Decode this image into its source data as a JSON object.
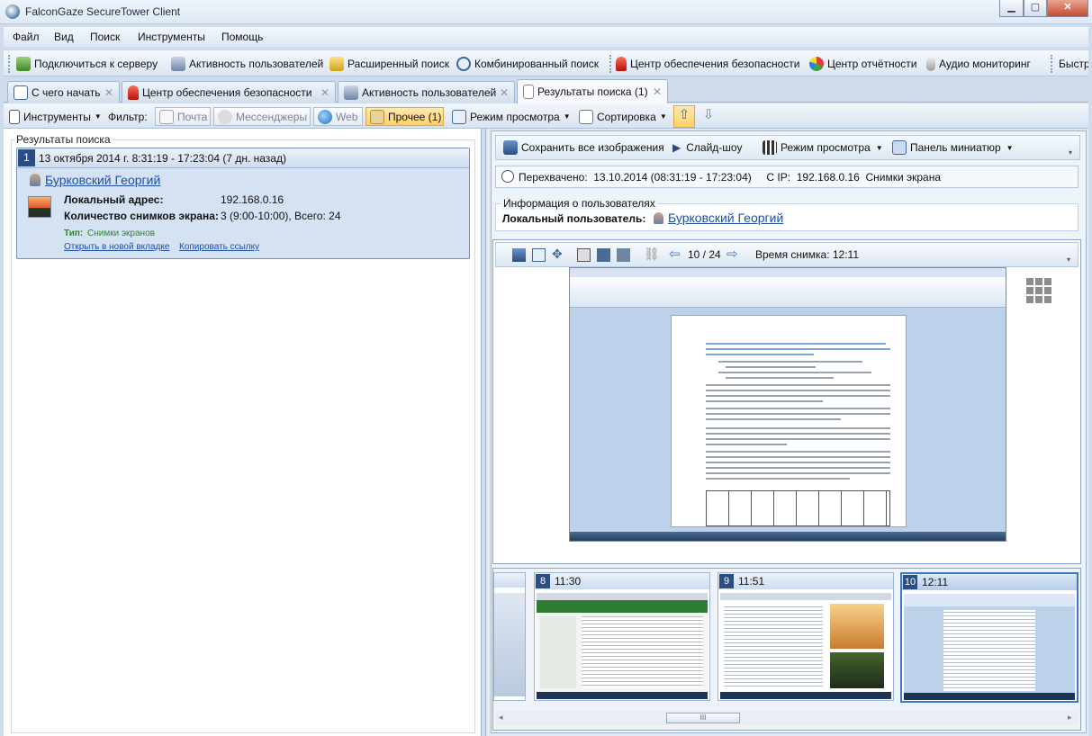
{
  "window": {
    "title": "FalconGaze SecureTower Client"
  },
  "menu": [
    "Файл",
    "Вид",
    "Поиск",
    "Инструменты",
    "Помощь"
  ],
  "toolbar": {
    "connect": "Подключиться к серверу",
    "user_activity": "Активность пользователей",
    "advanced_search": "Расширенный поиск",
    "combined_search": "Комбинированный поиск",
    "security_center": "Центр обеспечения безопасности",
    "reports_center": "Центр отчётности",
    "audio_monitoring": "Аудио мониторинг",
    "overflow": "Быстр"
  },
  "tabs": [
    {
      "label": "С чего начать",
      "icon": "list-icon"
    },
    {
      "label": "Центр обеспечения безопасности",
      "icon": "alarm-icon"
    },
    {
      "label": "Активность пользователей",
      "icon": "activity-icon"
    },
    {
      "label": "Результаты поиска (1)",
      "icon": "document-icon"
    }
  ],
  "filterbar": {
    "tools": "Инструменты",
    "filter_label": "Фильтр:",
    "mail": "Почта",
    "messengers": "Мессенджеры",
    "web": "Web",
    "other": "Прочее (1)",
    "view_mode": "Режим просмотра",
    "sorting": "Сортировка"
  },
  "left": {
    "group_title": "Результаты поиска",
    "result": {
      "index": "1",
      "header": "13 октября 2014 г. 8:31:19 - 17:23:04 (7 дн. назад)",
      "user": "Бурковский Георгий",
      "local_address_label": "Локальный адрес:",
      "local_address": "192.168.0.16",
      "screens_label": "Количество снимков экрана:",
      "screens_value": "3 (9:00-10:00), Всего: 24",
      "type_label": "Тип:",
      "type_value": "Снимки экранов",
      "open_tab": "Открыть в новой вкладке",
      "copy_link": "Копировать ссылку"
    }
  },
  "right": {
    "toolbar": {
      "save_all": "Сохранить все изображения",
      "slideshow": "Слайд-шоу",
      "view_mode": "Режим просмотра",
      "thumbs_panel": "Панель миниатюр"
    },
    "intercepted": "Перехвачено:  13.10.2014 (08:31:19 - 17:23:04)     С IP:  192.168.0.16  Снимки экрана",
    "user_info": {
      "title": "Информация о пользователях",
      "local_user_label": "Локальный пользователь:",
      "local_user": "Бурковский Георгий"
    },
    "viewer": {
      "counter": "10 / 24",
      "shot_time": "Время снимка: 12:11"
    },
    "thumbnails": [
      {
        "num": "8",
        "time": "11:30"
      },
      {
        "num": "9",
        "time": "11:51"
      },
      {
        "num": "10",
        "time": "12:11"
      }
    ],
    "scrollbar_grip": "III"
  },
  "colors": {
    "accent": "#2b4e82",
    "selected_filter": "#ffd06a",
    "link": "#1e4fa8",
    "card_bg": "#d5e2f1"
  }
}
